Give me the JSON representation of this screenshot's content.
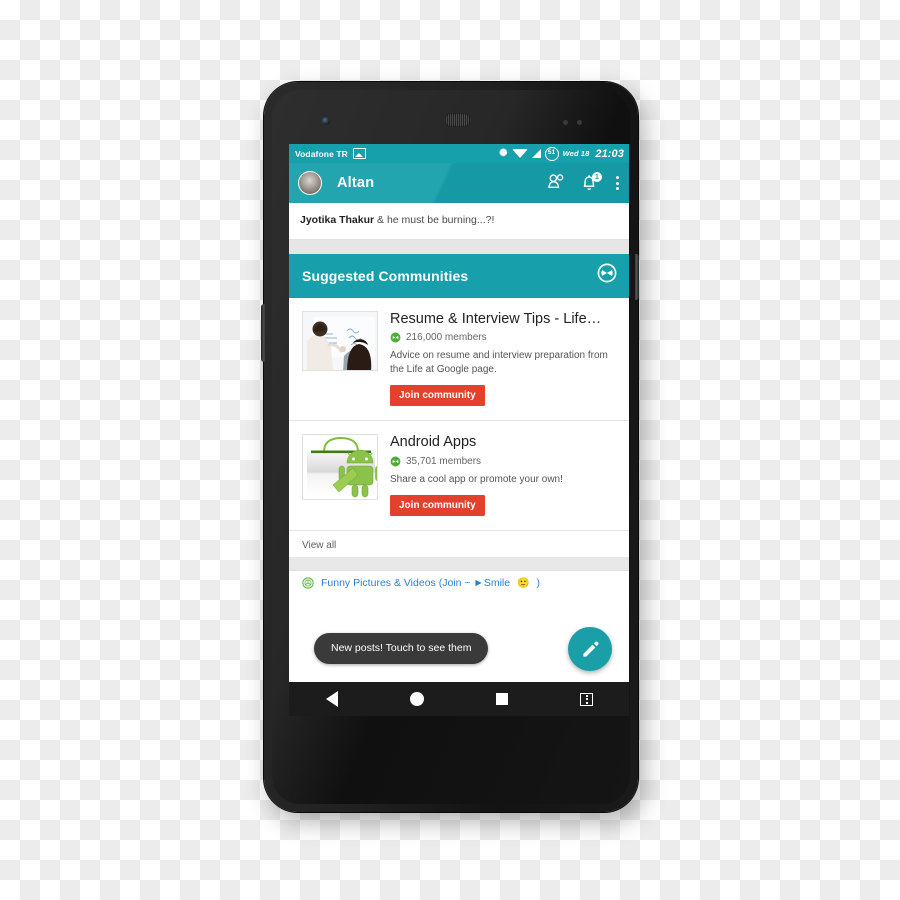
{
  "status_bar": {
    "carrier": "Vodafone TR",
    "photo_icon": "photo-icon",
    "bluetooth_icon": "bluetooth-icon",
    "wifi_icon": "wifi-icon",
    "signal_icon": "cell-signal-icon",
    "battery_percent": "51",
    "day": "Wed 18",
    "time": "21:03"
  },
  "action_bar": {
    "avatar_name": "avatar",
    "title": "Altan",
    "people_icon": "people-icon",
    "notifications_icon": "bell-icon",
    "notification_count": "1",
    "overflow_icon": "overflow-menu-icon"
  },
  "post_strip": {
    "author": "Jyotika Thakur",
    "text": " & he must be burning...?!"
  },
  "section": {
    "title": "Suggested Communities",
    "action_icon": "communities-icon"
  },
  "communities": [
    {
      "thumb": "whiteboard-photo",
      "title": "Resume & Interview Tips - Life…",
      "members": "216,000 members",
      "members_icon": "communities-icon",
      "description": "Advice on resume and interview preparation from the Life at Google page.",
      "join_label": "Join community"
    },
    {
      "thumb": "android-market-bag-icon",
      "title": "Android Apps",
      "members": "35,701 members",
      "members_icon": "communities-icon",
      "description": "Share a cool app or promote your own!",
      "join_label": "Join community"
    }
  ],
  "view_all_label": "View all",
  "bottom_link": {
    "icon": "communities-icon",
    "text": "Funny Pictures & Videos (Join  ~ ►Smile",
    "emoji": "🙂",
    "suffix": ")"
  },
  "toast": {
    "message": "New posts! Touch to see them"
  },
  "fab": {
    "icon": "pencil-icon",
    "label": "Compose post"
  },
  "nav_bar": {
    "back": "back-button",
    "home": "home-button",
    "recents": "recents-button",
    "menu": "menu-button"
  },
  "colors": {
    "accent_teal": "#16a0ab",
    "join_red": "#e4402e",
    "link_blue": "#2a7fd4",
    "members_green": "#4caf36",
    "toast_dark": "#3a3a3a"
  },
  "device": {
    "name": "android-phone-mockup"
  }
}
